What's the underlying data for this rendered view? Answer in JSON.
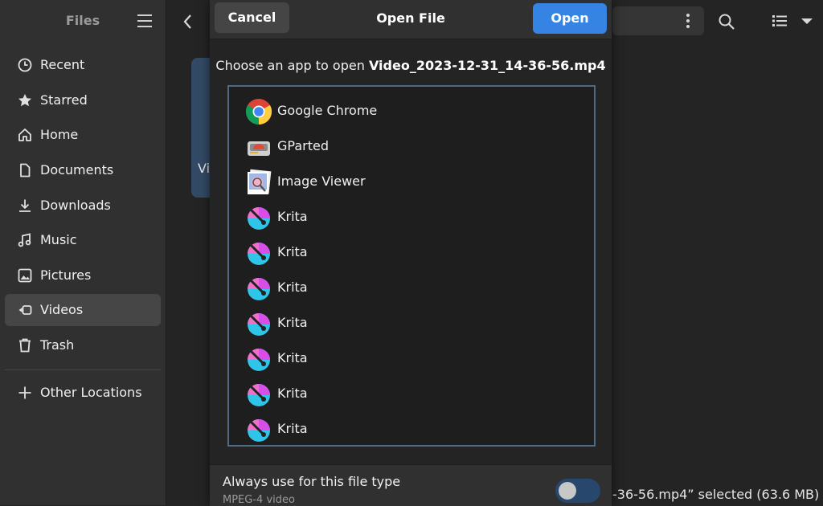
{
  "sidebar": {
    "title": "Files",
    "items": [
      {
        "label": "Recent",
        "icon": "clock-icon"
      },
      {
        "label": "Starred",
        "icon": "star-icon"
      },
      {
        "label": "Home",
        "icon": "home-icon"
      },
      {
        "label": "Documents",
        "icon": "document-icon"
      },
      {
        "label": "Downloads",
        "icon": "download-icon"
      },
      {
        "label": "Music",
        "icon": "music-icon"
      },
      {
        "label": "Pictures",
        "icon": "picture-icon"
      },
      {
        "label": "Videos",
        "icon": "video-icon",
        "active": true
      },
      {
        "label": "Trash",
        "icon": "trash-icon"
      }
    ],
    "other_locations": "Other Locations"
  },
  "main": {
    "tile_text": "Vi",
    "status": "-36-56.mp4” selected  (63.6 MB)"
  },
  "dialog": {
    "title": "Open File",
    "cancel_label": "Cancel",
    "open_label": "Open",
    "choose_prefix": "Choose an app to open ",
    "filename": "Video_2023-12-31_14-36-56.mp4",
    "apps": [
      {
        "name": "Google Chrome",
        "icon": "chrome-icon"
      },
      {
        "name": "GParted",
        "icon": "gparted-icon"
      },
      {
        "name": "Image Viewer",
        "icon": "image-viewer-icon"
      },
      {
        "name": "Krita",
        "icon": "krita-icon"
      },
      {
        "name": "Krita",
        "icon": "krita-icon"
      },
      {
        "name": "Krita",
        "icon": "krita-icon"
      },
      {
        "name": "Krita",
        "icon": "krita-icon"
      },
      {
        "name": "Krita",
        "icon": "krita-icon"
      },
      {
        "name": "Krita",
        "icon": "krita-icon"
      },
      {
        "name": "Krita",
        "icon": "krita-icon"
      }
    ],
    "always_label": "Always use for this file type",
    "mime_type": "MPEG-4 video",
    "always_enabled": false
  },
  "colors": {
    "accent": "#3584e4",
    "sidebar_bg": "#303030",
    "window_bg": "#242424",
    "list_border": "#4e6b86"
  }
}
